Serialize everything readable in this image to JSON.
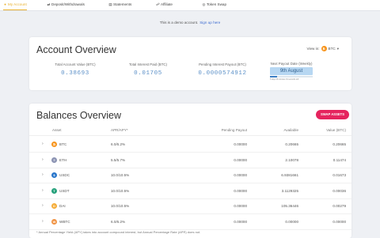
{
  "nav": {
    "tabs": [
      {
        "label": "My Account",
        "icon": "user-icon",
        "active": true
      },
      {
        "label": "Deposit/Withdrawals",
        "icon": "transfer-icon",
        "active": false
      },
      {
        "label": "Statements",
        "icon": "document-icon",
        "active": false
      },
      {
        "label": "Affiliate",
        "icon": "affiliate-icon",
        "active": false
      },
      {
        "label": "Token Swap",
        "icon": "swap-icon",
        "active": false
      }
    ]
  },
  "notice": {
    "text": "This is a demo account.",
    "link": "Sign up here"
  },
  "account": {
    "title": "Account Overview",
    "view_in_label": "View in:",
    "currency": "BTC",
    "stats": [
      {
        "label": "Total Account Value (BTC)",
        "value": "0.38693"
      },
      {
        "label": "Total Interest Paid (BTC)",
        "value": "0.01705"
      },
      {
        "label": "Pending Interest Payout (BTC)",
        "value": "0.0000574912"
      }
    ],
    "payout": {
      "label": "Next Payout Date (Weekly)",
      "date": "9th August",
      "progress": 0.16,
      "note": "5 days 18 minutes 31 seconds left"
    }
  },
  "balances": {
    "title": "Balances Overview",
    "swap_label": "SWAP ASSETS",
    "headers": {
      "asset": "Asset",
      "apy": "APR/APY*",
      "pending": "Pending Payout",
      "available": "Available",
      "value": "Value (BTC)"
    },
    "rows": [
      {
        "asset": "BTC",
        "apy": "6.0/6.2%",
        "pending": "0.00000",
        "available": "0.20665",
        "value": "0.20665",
        "color": "#f7931a",
        "glyph": "₿"
      },
      {
        "asset": "ETH",
        "apy": "5.5/5.7%",
        "pending": "0.00000",
        "available": "2.10078",
        "value": "0.11474",
        "color": "#8a92b2",
        "glyph": "Ξ"
      },
      {
        "asset": "USDC",
        "apy": "10.0/10.5%",
        "pending": "0.00000",
        "available": "6.9381661",
        "value": "0.01673",
        "color": "#2775ca",
        "glyph": "$"
      },
      {
        "asset": "USDT",
        "apy": "10.0/10.5%",
        "pending": "0.00000",
        "available": "3.1129325",
        "value": "0.00036",
        "color": "#26a17b",
        "glyph": "T"
      },
      {
        "asset": "DAI",
        "apy": "10.0/10.5%",
        "pending": "0.00000",
        "available": "105.36446",
        "value": "0.00279",
        "color": "#f5ac37",
        "glyph": "D"
      },
      {
        "asset": "WBTC",
        "apy": "6.0/6.2%",
        "pending": "0.00000",
        "available": "0.00000",
        "value": "0.00000",
        "color": "#f09242",
        "glyph": "W"
      }
    ]
  },
  "footnote": "* Annual Percentage Yield (APY) takes into account compound interest, but Annual Percentage Rate (APR) does not."
}
